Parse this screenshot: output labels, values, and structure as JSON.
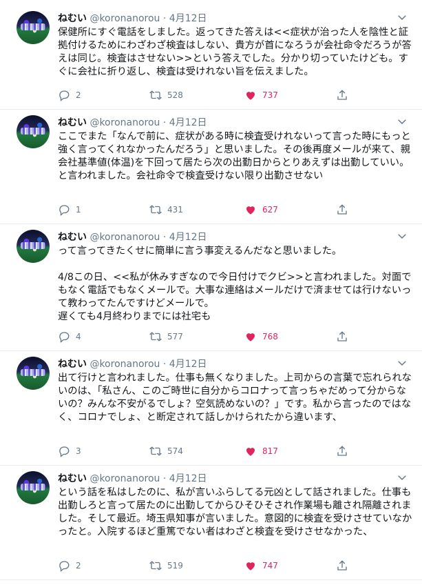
{
  "tweets": [
    {
      "name": "ねむい",
      "handle": "@koronanorou",
      "sep": "·",
      "date": "4月12日",
      "text": "保健所にすぐ電話をしました。返ってきた答えは<<症状が治った人を陰性と証拠付けるためにわざわざ検査はしない、貴方が首になろうが会社命令だろうが答えは同じ。検査はさせない>>という答えでした。分かり切っていたけども。すぐに会社に折り返し、検査は受けれない旨を伝えました。",
      "replies": "2",
      "retweets": "528",
      "likes": "737"
    },
    {
      "name": "ねむい",
      "handle": "@koronanorou",
      "sep": "·",
      "date": "4月12日",
      "text": "ここでまた「なんで前に、症状がある時に検査受けれないって言った時にもっと強く言ってくれなかったんだろう」と思いました。その後再度メールが来て、親会社基準値(体温)を下回って居たら次の出勤日からとりあえずは出勤していい。と言われました。会社命令で検査受けない限り出勤させない",
      "replies": "1",
      "retweets": "431",
      "likes": "627"
    },
    {
      "name": "ねむい",
      "handle": "@koronanorou",
      "sep": "·",
      "date": "4月12日",
      "text": "って言ってきたくせに簡単に言う事変えるんだなと思いました。\n\n4/8この日、<<私が休みすぎなので今日付けでクビ>>と言われました。対面でもなく電話でもなくメールで。大事な連絡はメールだけで済ませては行けないって教わってたんですけどメールで。\n遅くても4月終わりまでには社宅も",
      "replies": "4",
      "retweets": "577",
      "likes": "768"
    },
    {
      "name": "ねむい",
      "handle": "@koronanorou",
      "sep": "·",
      "date": "4月12日",
      "text": "出て行けと言われました。仕事も無くなりました。上司からの言葉で忘れられないのは、「私さん、このご時世に自分からコロナって言っちゃだめって分からないの？みんな不安がるでしょ？空気読めないの？」です。私から言ったのではなく、コロナでしょ、と断定されて話しかけられたから違います、",
      "replies": "3",
      "retweets": "574",
      "likes": "817"
    },
    {
      "name": "ねむい",
      "handle": "@koronanorou",
      "sep": "·",
      "date": "4月12日",
      "text": "という話を私はしたのに、私が言いふらしてる元凶として話されました。仕事も出勤しろと言って居たのに出勤してからひそひそされ作業場も離され隔離されました。そして最近。埼玉県知事が言いました。意図的に検査を受けさせていなかったと。入院するほど重篤でない者はわざと検査を受けさせなかった、",
      "replies": "2",
      "retweets": "519",
      "likes": "747"
    }
  ],
  "colors": {
    "like": "#e0245e",
    "muted": "#657786",
    "text": "#14171a",
    "divider": "#e6ecf0"
  },
  "icons": {
    "reply": "reply-icon",
    "retweet": "retweet-icon",
    "like": "heart-icon",
    "share": "share-icon",
    "menu": "chevron-down-icon"
  }
}
